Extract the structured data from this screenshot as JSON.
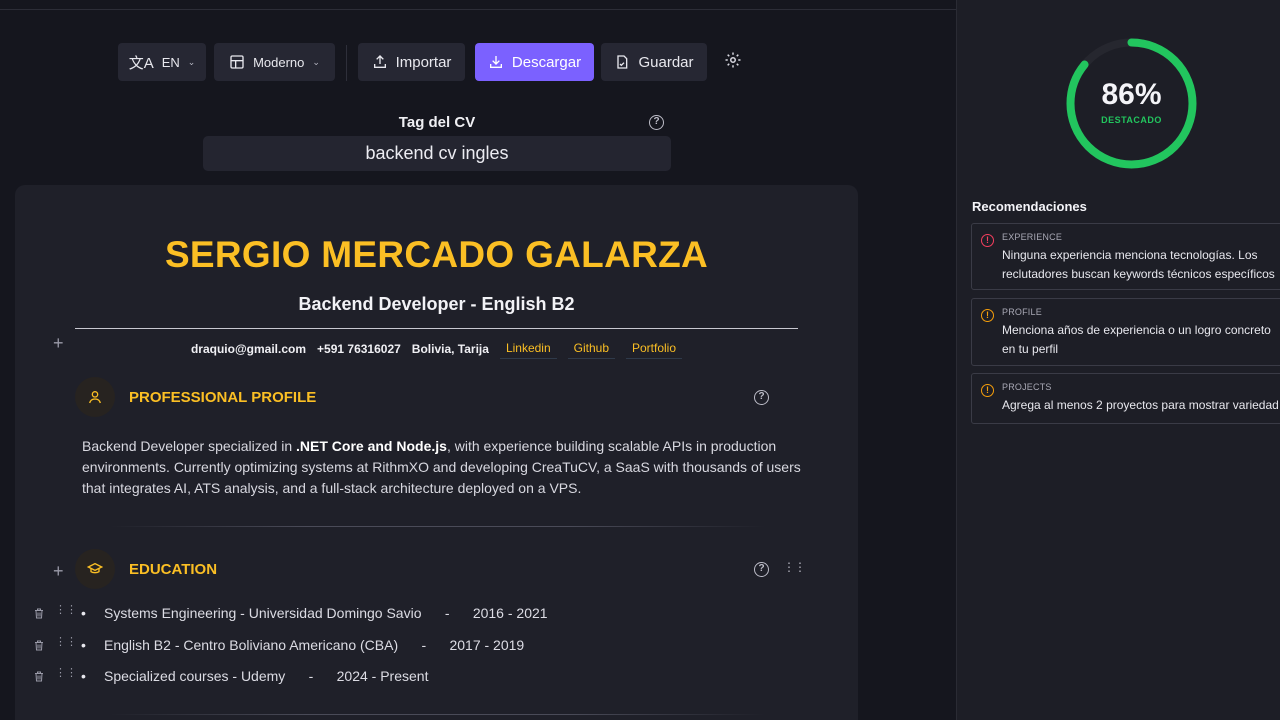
{
  "toolbar": {
    "language": "EN",
    "template": "Moderno",
    "import_label": "Importar",
    "download_label": "Descargar",
    "save_label": "Guardar"
  },
  "tag": {
    "label": "Tag del CV",
    "value": "backend cv ingles"
  },
  "cv": {
    "name": "SERGIO MERCADO GALARZA",
    "role": "Backend Developer - English B2",
    "contact": {
      "email": "draquio@gmail.com",
      "phone": "+591 76316027",
      "location": "Bolivia, Tarija",
      "links": [
        "Linkedin",
        "Github",
        "Portfolio"
      ]
    },
    "profile": {
      "title": "PROFESSIONAL PROFILE",
      "text_before": "Backend Developer specialized in ",
      "text_bold": ".NET Core and Node.js",
      "text_after": ", with experience building scalable APIs in production environments. Currently optimizing systems at RithmXO and developing CreaTuCV, a SaaS with thousands of users that integrates AI, ATS analysis, and a full-stack architecture deployed on a VPS."
    },
    "education": {
      "title": "EDUCATION",
      "items": [
        {
          "text": "Systems Engineering - Universidad Domingo Savio      -      2016 - 2021"
        },
        {
          "text": "English B2 - Centro Boliviano Americano (CBA)      -      2017 - 2019"
        },
        {
          "text": "Specialized courses - Udemy      -      2024 - Present"
        }
      ]
    }
  },
  "score": {
    "percent_label": "86%",
    "value": 0.86,
    "status": "DESTACADO",
    "color": "#22c55e"
  },
  "recommendations": {
    "title": "Recomendaciones",
    "items": [
      {
        "category": "EXPERIENCE",
        "message": "Ninguna experiencia menciona tecnologías. Los reclutadores buscan keywords técnicos específicos",
        "color": "#f43f5e"
      },
      {
        "category": "PROFILE",
        "message": "Menciona años de experiencia o un logro concreto en tu perfil",
        "color": "#f59e0b"
      },
      {
        "category": "PROJECTS",
        "message": "Agrega al menos 2 proyectos para mostrar variedad",
        "color": "#f59e0b"
      }
    ]
  }
}
